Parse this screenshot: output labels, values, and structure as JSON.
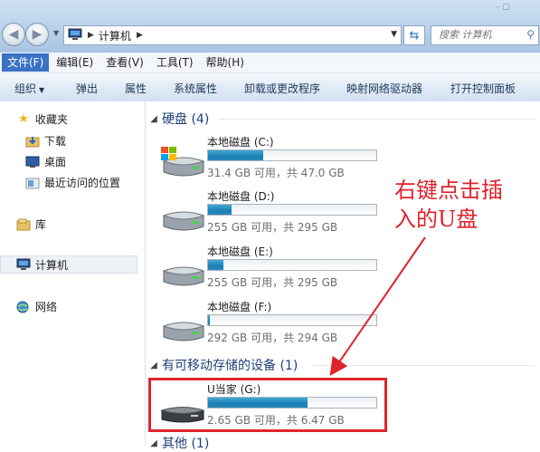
{
  "address": {
    "crumb": "计算机"
  },
  "search": {
    "placeholder": "搜索 计算机"
  },
  "menu": [
    "文件(F)",
    "编辑(E)",
    "查看(V)",
    "工具(T)",
    "帮助(H)"
  ],
  "toolbar": {
    "organize": "组织",
    "eject": "弹出",
    "properties": "属性",
    "system_properties": "系统属性",
    "uninstall": "卸载或更改程序",
    "map_drive": "映射网络驱动器",
    "control_panel": "打开控制面板"
  },
  "sidebar": {
    "favorites": "收藏夹",
    "downloads": "下载",
    "desktop": "桌面",
    "recent": "最近访问的位置",
    "libraries": "库",
    "computer": "计算机",
    "network": "网络"
  },
  "groups": {
    "hard_disks": "硬盘 (4)",
    "removable": "有可移动存储的设备 (1)",
    "other": "其他 (1)"
  },
  "drives": [
    {
      "name": "本地磁盘 (C:)",
      "info": "31.4 GB 可用，共 47.0 GB",
      "used_fraction": 0.33
    },
    {
      "name": "本地磁盘 (D:)",
      "info": "255 GB 可用，共 295 GB",
      "used_fraction": 0.14
    },
    {
      "name": "本地磁盘 (E:)",
      "info": "255 GB 可用，共 295 GB",
      "used_fraction": 0.09
    },
    {
      "name": "本地磁盘 (F:)",
      "info": "292 GB 可用，共 294 GB",
      "used_fraction": 0.01
    }
  ],
  "usb": {
    "name": "U当家 (G:)",
    "info": "2.65 GB 可用，共 6.47 GB",
    "used_fraction": 0.59
  },
  "annotation": {
    "line1": "右键点击插",
    "line2": "入的U盘"
  },
  "colors": {
    "annotation": "#e0222a",
    "bar_fill": "#1c7fb4",
    "menu_active": "#3a72c4"
  }
}
